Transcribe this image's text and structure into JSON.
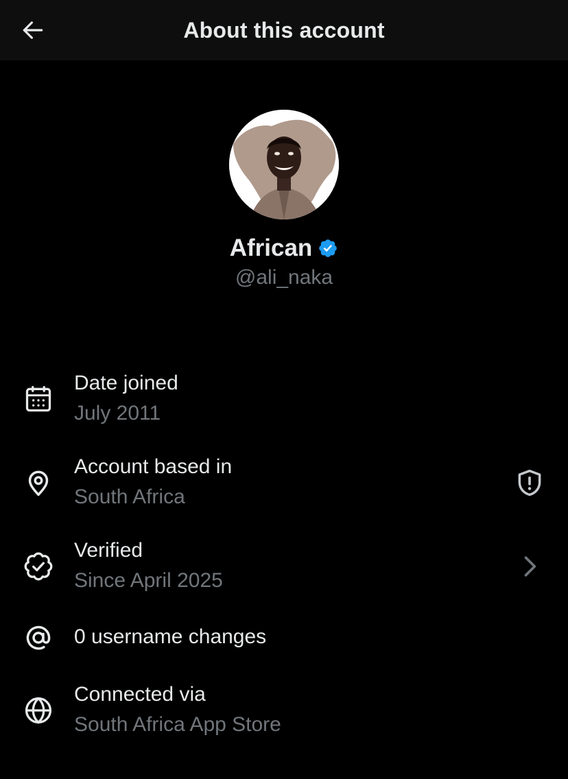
{
  "header": {
    "back_icon": "arrow-left-icon",
    "title": "About this account"
  },
  "profile": {
    "avatar_icon": "profile-photo",
    "display_name": "African",
    "verified_icon": "verified-badge-icon",
    "verified_color": "#1d9bf0",
    "handle": "@ali_naka"
  },
  "details": [
    {
      "icon": "calendar-icon",
      "label": "Date joined",
      "value": "July 2011"
    },
    {
      "icon": "location-pin-icon",
      "label": "Account based in",
      "value": "South Africa",
      "trailing_icon": "shield-alert-icon"
    },
    {
      "icon": "verified-check-icon",
      "label": "Verified",
      "value": "Since April 2025",
      "trailing_icon": "chevron-right-icon"
    },
    {
      "icon": "at-sign-icon",
      "label": "0 username changes"
    },
    {
      "icon": "globe-icon",
      "label": "Connected via",
      "value": "South Africa App Store"
    }
  ],
  "colors": {
    "background": "#000000",
    "header_background": "#0e0e0e",
    "primary_text": "#e7e9ea",
    "secondary_text": "#71767b"
  }
}
